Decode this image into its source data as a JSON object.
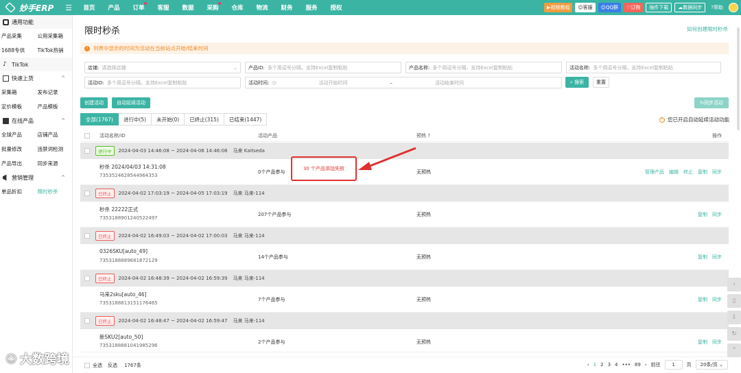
{
  "app": {
    "logo_text": "妙手ERP"
  },
  "nav": [
    "首页",
    "产品",
    "订单",
    "客服",
    "数据",
    "采购",
    "仓库",
    "物流",
    "财务",
    "服务",
    "授权"
  ],
  "topright": {
    "video": "视频教程",
    "kefu": "客服",
    "qq": "QQ群",
    "dingdou": "订购",
    "plugin": "插件下载",
    "sync": "数据同步",
    "help": "帮助"
  },
  "sidebar": {
    "common": "通用功能",
    "r1": [
      "产品采集",
      "公用采集箱"
    ],
    "r2": [
      "1688专供",
      "TikTok热销"
    ],
    "tiktok": "TikTok",
    "quick": "快速上货",
    "r3": [
      "采集箱",
      "发布记录"
    ],
    "r4": [
      "定价模板",
      "产品模板"
    ],
    "online": "在线产品",
    "r5": [
      "全球产品",
      "店铺产品"
    ],
    "r6": [
      "批量修改",
      "违禁词检测"
    ],
    "r7": [
      "产品导出",
      "同步来源"
    ],
    "marketing": "营销管理",
    "r8": [
      "单品折扣",
      "限时秒杀"
    ]
  },
  "page": {
    "title": "限时秒杀",
    "howto": "如何创建限时秒杀",
    "notice": "列表中显示的时间为活动在当前站点开始/结束时间"
  },
  "filters": {
    "shop_label": "店铺:",
    "shop_ph": "请选择店铺",
    "pid_label": "产品ID:",
    "pid_ph": "多个用逗号分隔，支持Excel复制粘贴",
    "pname_label": "产品名称:",
    "pname_ph": "多个用逗号分隔，支持Excel复制粘贴",
    "aname_label": "活动名称:",
    "aname_ph": "多个用逗号分隔，支持Excel复制粘贴",
    "aid_label": "活动ID:",
    "aid_ph": "多个用逗号分隔，支持Excel复制粘贴",
    "atime_label": "活动时间:",
    "start_ph": "活动开始时间",
    "dash": "–",
    "end_ph": "活动结束时间",
    "search": "搜索",
    "reset": "重置"
  },
  "actions": {
    "create": "创建活动",
    "auto_extend": "自动延续活动",
    "sync": "同步活动"
  },
  "tabs": [
    "全部(1767)",
    "进行中(5)",
    "未开始(0)",
    "已终止(315)",
    "已结束(1447)"
  ],
  "auto_note": "您已开启自动延续活动功能",
  "table_head": {
    "name": "活动名称/ID",
    "products": "活动产品",
    "preheat": "预热",
    "ops": "操作"
  },
  "groups": [
    {
      "status": "进行中",
      "time": "2024-04-03 14:46:08 ~ 2024-04-06 14:46:08",
      "shop": "马来 Kaitseda",
      "name": "秒杀 2024/04/03 14:31:08",
      "id": "7353524628544964353",
      "products": "0个产品参与",
      "fail": "30 个产品添加失败",
      "preheat": "无预热",
      "ops": [
        "管理产品",
        "编辑",
        "终止",
        "复制",
        "同步"
      ]
    },
    {
      "status": "已终止",
      "time": "2024-04-02 17:03:19 ~ 2024-04-05 17:03:19",
      "shop": "马来 马来-114",
      "name": "秒杀 22222正式",
      "id": "7353188901240522497",
      "products": "207个产品参与",
      "preheat": "无预热",
      "ops": [
        "复制",
        "同步"
      ]
    },
    {
      "status": "已终止",
      "time": "2024-04-02 16:49:03 ~ 2024-04-02 17:00:03",
      "shop": "马来 马来-114",
      "name": "0326SKU[auto_49]",
      "id": "7353188889681872129",
      "products": "14个产品参与",
      "preheat": "无预热",
      "ops": [
        "复制",
        "同步"
      ]
    },
    {
      "status": "已终止",
      "time": "2024-04-02 16:48:39 ~ 2024-04-02 16:59:39",
      "shop": "马来 马来-114",
      "name": "马来2sku[auto_46]",
      "id": "7353188813151176465",
      "products": "7个产品参与",
      "preheat": "无预热",
      "ops": [
        "复制",
        "同步"
      ]
    },
    {
      "status": "已终止",
      "time": "2024-04-02 16:48:47 ~ 2024-04-02 16:59:47",
      "shop": "马来 马来-114",
      "name": "新SKU2[auto_50]",
      "id": "7353188881041985296",
      "products": "2个产品参与",
      "preheat": "无预热",
      "ops": [
        "复制",
        "同步"
      ]
    }
  ],
  "footer": {
    "select_all": "全选",
    "invert": "反选",
    "count": "1767条",
    "pages": [
      "1",
      "2",
      "3",
      "4",
      "•••",
      "89"
    ],
    "goto": "前往",
    "page_input": "1",
    "page_unit": "页",
    "per_page": "20条/页"
  },
  "watermark": "大数跨境"
}
